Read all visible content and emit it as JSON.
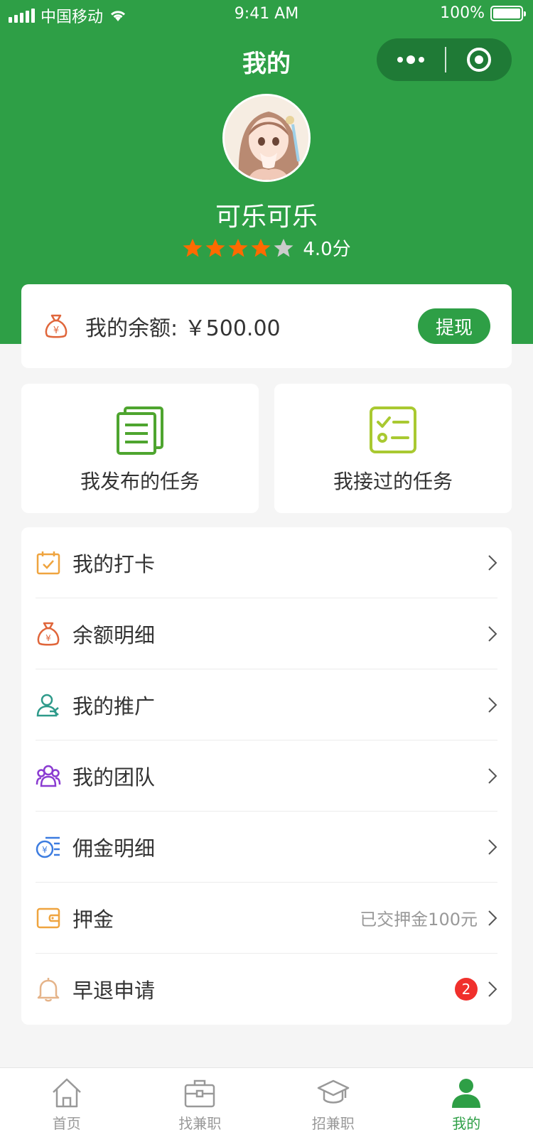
{
  "status_bar": {
    "carrier": "中国移动",
    "time": "9:41 AM",
    "battery": "100%"
  },
  "nav": {
    "title": "我的"
  },
  "profile": {
    "username": "可乐可乐",
    "rating_value": 4,
    "rating_max": 5,
    "score_text": "4.0分"
  },
  "balance": {
    "text": "我的余额: ￥500.00",
    "withdraw_label": "提现"
  },
  "task_cards": {
    "published_label": "我发布的任务",
    "accepted_label": "我接过的任务"
  },
  "menu": {
    "items": [
      {
        "label": "我的打卡",
        "icon": "calendar-check-icon"
      },
      {
        "label": "余额明细",
        "icon": "money-bag-icon"
      },
      {
        "label": "我的推广",
        "icon": "promote-icon"
      },
      {
        "label": "我的团队",
        "icon": "team-icon"
      },
      {
        "label": "佣金明细",
        "icon": "coin-list-icon"
      },
      {
        "label": "押金",
        "icon": "wallet-icon",
        "extra": "已交押金100元"
      },
      {
        "label": "早退申请",
        "icon": "bell-icon",
        "badge": "2"
      }
    ]
  },
  "tabbar": {
    "items": [
      {
        "label": "首页",
        "icon": "home-icon"
      },
      {
        "label": "找兼职",
        "icon": "briefcase-icon"
      },
      {
        "label": "招兼职",
        "icon": "graduation-cap-icon"
      },
      {
        "label": "我的",
        "icon": "user-icon",
        "active": true
      }
    ]
  },
  "colors": {
    "primary": "#2e9f46",
    "star_active": "#ff6a00",
    "star_inactive": "#cccccc",
    "badge": "#f0302c"
  }
}
